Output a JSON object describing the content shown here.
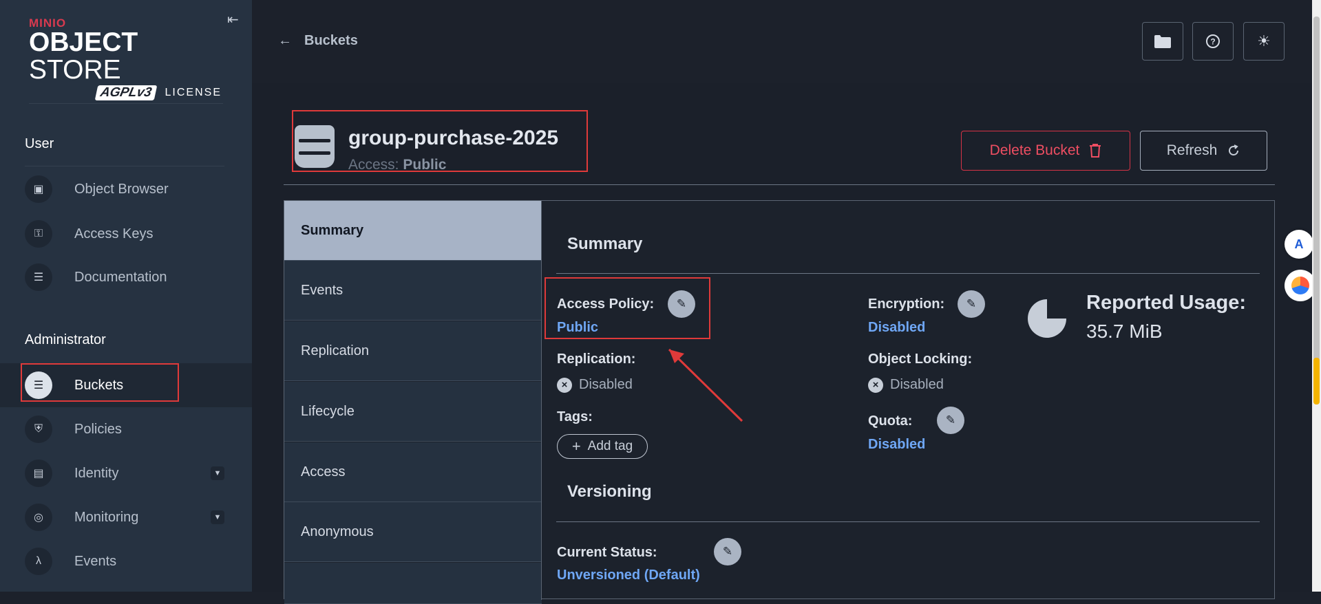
{
  "logo": {
    "brand": "MINIO",
    "product_bold": "OBJECT",
    "product_light": " STORE",
    "license_badge": "AGPLv3",
    "license_text": "LICENSE"
  },
  "sidebar": {
    "section_user": "User",
    "section_admin": "Administrator",
    "items_user": [
      {
        "label": "Object Browser",
        "icon": "object-browser-icon"
      },
      {
        "label": "Access Keys",
        "icon": "access-keys-icon"
      },
      {
        "label": "Documentation",
        "icon": "documentation-icon"
      }
    ],
    "items_admin": [
      {
        "label": "Buckets",
        "icon": "bucket-icon",
        "active": true
      },
      {
        "label": "Policies",
        "icon": "shield-icon"
      },
      {
        "label": "Identity",
        "icon": "id-card-icon",
        "expandable": true
      },
      {
        "label": "Monitoring",
        "icon": "monitoring-icon",
        "expandable": true
      },
      {
        "label": "Events",
        "icon": "lambda-icon"
      }
    ]
  },
  "header": {
    "back_label": "Buckets",
    "buttons": [
      "folder-icon",
      "help-icon",
      "theme-toggle-icon"
    ]
  },
  "bucket": {
    "name": "group-purchase-2025",
    "access_prefix": "Access: ",
    "access_value": "Public",
    "delete_label": "Delete Bucket",
    "refresh_label": "Refresh"
  },
  "tabs": [
    "Summary",
    "Events",
    "Replication",
    "Lifecycle",
    "Access",
    "Anonymous"
  ],
  "summary": {
    "title": "Summary",
    "access_policy_label": "Access Policy:",
    "access_policy_value": "Public",
    "encryption_label": "Encryption:",
    "encryption_value": "Disabled",
    "replication_label": "Replication:",
    "replication_value": "Disabled",
    "object_locking_label": "Object Locking:",
    "object_locking_value": "Disabled",
    "tags_label": "Tags:",
    "add_tag_label": "Add tag",
    "quota_label": "Quota:",
    "quota_value": "Disabled",
    "usage_label": "Reported Usage:",
    "usage_value": "35.7 MiB"
  },
  "versioning": {
    "title": "Versioning",
    "status_label": "Current Status:",
    "status_value": "Unversioned (Default)"
  },
  "colors": {
    "accent_link": "#6fa7f5",
    "danger": "#ee4e62",
    "annotation": "#e03a3a",
    "active_tab": "#a7b3c6"
  }
}
